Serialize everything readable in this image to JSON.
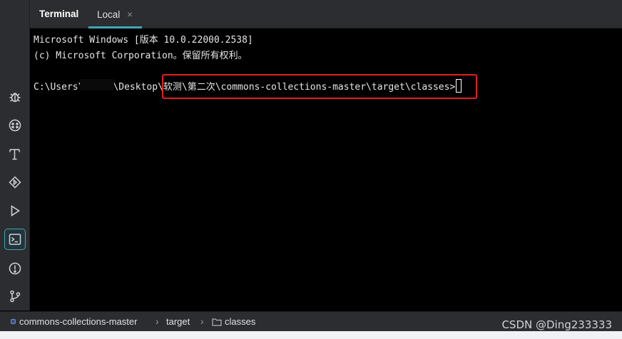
{
  "header": {
    "tool_title": "Terminal",
    "tabs": [
      {
        "label": "Local",
        "close_glyph": "×",
        "active": true
      }
    ]
  },
  "sidebar": {
    "items": [
      {
        "icon": "bug-icon",
        "label": "Debug"
      },
      {
        "icon": "services-icon",
        "label": "Services"
      },
      {
        "icon": "build-icon",
        "label": "Build"
      },
      {
        "icon": "endpoints-icon",
        "label": "Endpoints"
      },
      {
        "icon": "run-icon",
        "label": "Run"
      },
      {
        "icon": "terminal-icon",
        "label": "Terminal",
        "active": true
      },
      {
        "icon": "problems-icon",
        "label": "Problems"
      },
      {
        "icon": "git-icon",
        "label": "Git"
      }
    ]
  },
  "terminal": {
    "lines": [
      "Microsoft Windows [版本 10.0.22000.2538]",
      "(c) Microsoft Corporation。保留所有权利。",
      ""
    ],
    "prompt_prefix": "C:\\Users\\",
    "prompt_after_redaction": "\\Desktop\\",
    "prompt_highlighted": "软测\\第二次\\commons-collections-master\\target\\classes>",
    "highlight_color": "#e02020",
    "accent_color": "#3fa8b4"
  },
  "breadcrumb": {
    "items": [
      {
        "label": "commons-collections-master",
        "icon": "module-icon"
      },
      {
        "label": "target"
      },
      {
        "label": "classes",
        "icon": "folder-icon"
      }
    ],
    "separator": "›"
  },
  "watermark": "CSDN @Ding233333"
}
